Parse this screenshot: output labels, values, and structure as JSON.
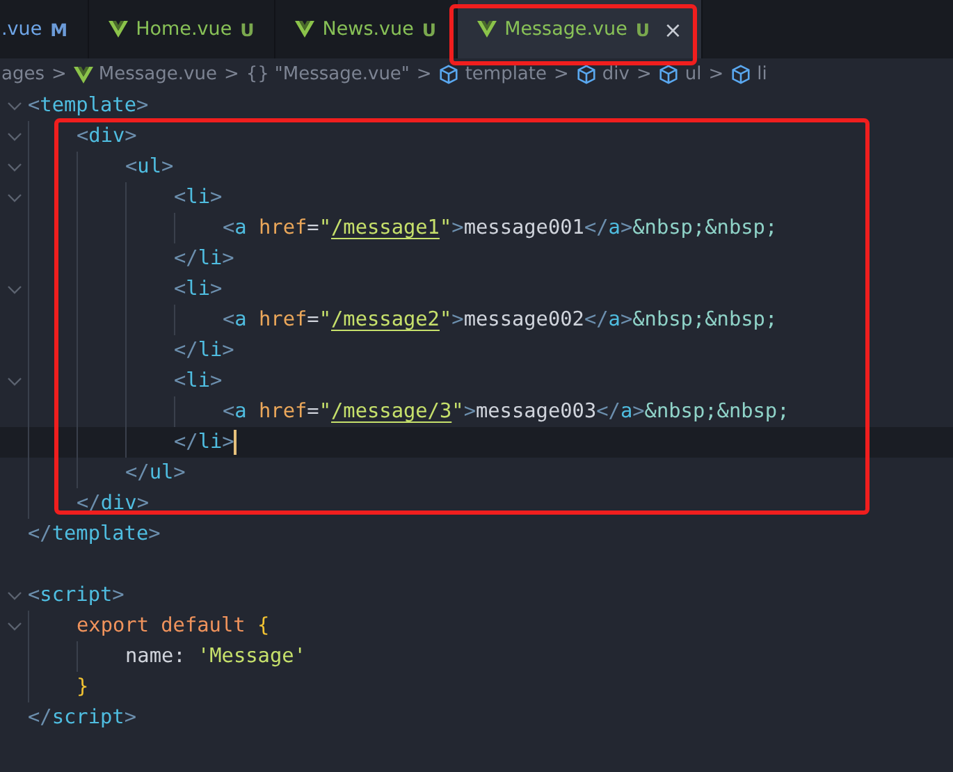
{
  "tabs": [
    {
      "label": ".vue",
      "status": "M",
      "selected": false,
      "modified": true
    },
    {
      "label": "Home.vue",
      "status": "U",
      "selected": false,
      "modified": false
    },
    {
      "label": "News.vue",
      "status": "U",
      "selected": false,
      "modified": false
    },
    {
      "label": "Message.vue",
      "status": "U",
      "selected": true,
      "modified": false,
      "close": "×"
    }
  ],
  "breadcrumb": [
    {
      "label": "ages"
    },
    {
      "label": "Message.vue"
    },
    {
      "symbol": "{}",
      "label": "\"Message.vue\""
    },
    {
      "label": "template"
    },
    {
      "label": "div"
    },
    {
      "label": "ul"
    },
    {
      "label": "li"
    }
  ],
  "breadcrumb_separator": ">",
  "code": [
    {
      "tokens": [
        {
          "text": "<",
          "kind": "punct"
        },
        {
          "text": "template",
          "kind": "tag"
        },
        {
          "text": ">",
          "kind": "punct"
        }
      ],
      "expanded": true,
      "children": [
        {
          "tokens": [
            {
              "text": "<",
              "kind": "punct"
            },
            {
              "text": "div",
              "kind": "tag"
            },
            {
              "text": ">",
              "kind": "punct"
            }
          ],
          "expanded": true,
          "children": [
            {
              "tokens": [
                {
                  "text": "<",
                  "kind": "punct"
                },
                {
                  "text": "ul",
                  "kind": "tag"
                },
                {
                  "text": ">",
                  "kind": "punct"
                }
              ],
              "expanded": true,
              "children": [
                {
                  "tokens": [
                    {
                      "text": "<",
                      "kind": "punct"
                    },
                    {
                      "text": "li",
                      "kind": "tag"
                    },
                    {
                      "text": ">",
                      "kind": "punct"
                    }
                  ],
                  "expanded": true,
                  "children": [
                    {
                      "tokens": [
                        {
                          "text": "<",
                          "kind": "punct"
                        },
                        {
                          "text": "a",
                          "kind": "tag"
                        },
                        {
                          "text": "href",
                          "kind": "attr"
                        },
                        {
                          "text": "=",
                          "kind": "op"
                        },
                        {
                          "text": "\"",
                          "kind": "string"
                        },
                        {
                          "text": "/message1",
                          "kind": "path"
                        },
                        {
                          "text": "\"",
                          "kind": "string"
                        },
                        {
                          "text": ">",
                          "kind": "punct"
                        },
                        {
                          "text": "message001",
                          "kind": "text"
                        },
                        {
                          "text": "</",
                          "kind": "punct"
                        },
                        {
                          "text": "a",
                          "kind": "tag"
                        },
                        {
                          "text": ">",
                          "kind": "punct"
                        },
                        {
                          "text": "&nbsp;&nbsp;",
                          "kind": "entity"
                        }
                      ]
                    }
                  ]
                },
                {
                  "tokens": [
                    {
                      "text": "</",
                      "kind": "punct"
                    },
                    {
                      "text": "li",
                      "kind": "tag"
                    },
                    {
                      "text": ">",
                      "kind": "punct"
                    }
                  ]
                },
                {
                  "tokens": [
                    {
                      "text": "<",
                      "kind": "punct"
                    },
                    {
                      "text": "li",
                      "kind": "tag"
                    },
                    {
                      "text": ">",
                      "kind": "punct"
                    }
                  ],
                  "expanded": true,
                  "children": [
                    {
                      "tokens": [
                        {
                          "text": "<",
                          "kind": "punct"
                        },
                        {
                          "text": "a",
                          "kind": "tag"
                        },
                        {
                          "text": "href",
                          "kind": "attr"
                        },
                        {
                          "text": "=",
                          "kind": "op"
                        },
                        {
                          "text": "\"",
                          "kind": "string"
                        },
                        {
                          "text": "/message2",
                          "kind": "path"
                        },
                        {
                          "text": "\"",
                          "kind": "string"
                        },
                        {
                          "text": ">",
                          "kind": "punct"
                        },
                        {
                          "text": "message002",
                          "kind": "text"
                        },
                        {
                          "text": "</",
                          "kind": "punct"
                        },
                        {
                          "text": "a",
                          "kind": "tag"
                        },
                        {
                          "text": ">",
                          "kind": "punct"
                        },
                        {
                          "text": "&nbsp;&nbsp;",
                          "kind": "entity"
                        }
                      ]
                    }
                  ]
                },
                {
                  "tokens": [
                    {
                      "text": "</",
                      "kind": "punct"
                    },
                    {
                      "text": "li",
                      "kind": "tag"
                    },
                    {
                      "text": ">",
                      "kind": "punct"
                    }
                  ]
                },
                {
                  "tokens": [
                    {
                      "text": "<",
                      "kind": "punct"
                    },
                    {
                      "text": "li",
                      "kind": "tag"
                    },
                    {
                      "text": ">",
                      "kind": "punct"
                    }
                  ],
                  "expanded": true,
                  "children": [
                    {
                      "tokens": [
                        {
                          "text": "<",
                          "kind": "punct"
                        },
                        {
                          "text": "a",
                          "kind": "tag"
                        },
                        {
                          "text": "href",
                          "kind": "attr"
                        },
                        {
                          "text": "=",
                          "kind": "op"
                        },
                        {
                          "text": "\"",
                          "kind": "string"
                        },
                        {
                          "text": "/message/3",
                          "kind": "path"
                        },
                        {
                          "text": "\"",
                          "kind": "string"
                        },
                        {
                          "text": ">",
                          "kind": "punct"
                        },
                        {
                          "text": "message003",
                          "kind": "text"
                        },
                        {
                          "text": "</",
                          "kind": "punct"
                        },
                        {
                          "text": "a",
                          "kind": "tag"
                        },
                        {
                          "text": ">",
                          "kind": "punct"
                        },
                        {
                          "text": "&nbsp;&nbsp;",
                          "kind": "entity"
                        }
                      ]
                    }
                  ]
                },
                {
                  "tokens": [
                    {
                      "text": "</",
                      "kind": "punct"
                    },
                    {
                      "text": "li",
                      "kind": "tag"
                    },
                    {
                      "text": ">",
                      "kind": "punct"
                    }
                  ],
                  "current": true
                }
              ]
            },
            {
              "tokens": [
                {
                  "text": "</",
                  "kind": "punct"
                },
                {
                  "text": "ul",
                  "kind": "tag"
                },
                {
                  "text": ">",
                  "kind": "punct"
                }
              ]
            }
          ]
        },
        {
          "tokens": [
            {
              "text": "</",
              "kind": "punct"
            },
            {
              "text": "div",
              "kind": "tag"
            },
            {
              "text": ">",
              "kind": "punct"
            }
          ]
        }
      ]
    },
    {
      "tokens": [
        {
          "text": "</",
          "kind": "punct"
        },
        {
          "text": "template",
          "kind": "tag"
        },
        {
          "text": ">",
          "kind": "punct"
        }
      ]
    },
    {
      "blank": true
    },
    {
      "tokens": [
        {
          "text": "<",
          "kind": "punct"
        },
        {
          "text": "script",
          "kind": "tag"
        },
        {
          "text": ">",
          "kind": "punct"
        }
      ],
      "expanded": true,
      "children": [
        {
          "tokens": [
            {
              "text": "export",
              "kind": "keyword"
            },
            {
              "text": "default",
              "kind": "keyword"
            },
            {
              "text": "{",
              "kind": "brace"
            }
          ],
          "expanded": true,
          "children": [
            {
              "tokens": [
                {
                  "text": "name:",
                  "kind": "prop"
                },
                {
                  "text": "'Message'",
                  "kind": "string"
                }
              ]
            }
          ]
        },
        {
          "tokens": [
            {
              "text": "}",
              "kind": "brace"
            }
          ]
        }
      ]
    },
    {
      "tokens": [
        {
          "text": "</",
          "kind": "punct"
        },
        {
          "text": "script",
          "kind": "tag"
        },
        {
          "text": ">",
          "kind": "punct"
        }
      ]
    }
  ]
}
